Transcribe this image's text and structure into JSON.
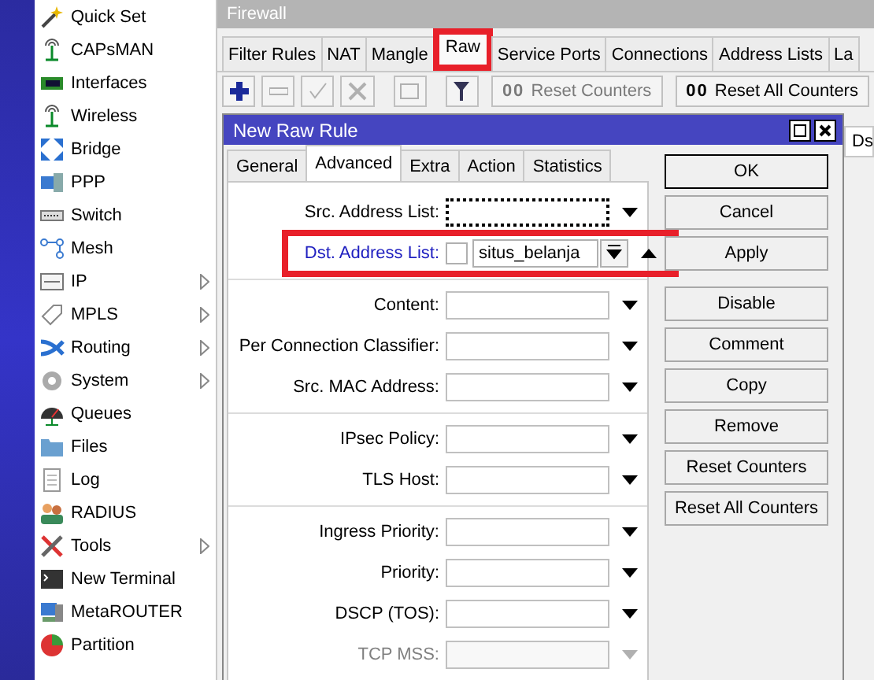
{
  "sidebar": {
    "items": [
      {
        "label": "Quick Set",
        "submenu": false
      },
      {
        "label": "CAPsMAN",
        "submenu": false
      },
      {
        "label": "Interfaces",
        "submenu": false
      },
      {
        "label": "Wireless",
        "submenu": false
      },
      {
        "label": "Bridge",
        "submenu": false
      },
      {
        "label": "PPP",
        "submenu": false
      },
      {
        "label": "Switch",
        "submenu": false
      },
      {
        "label": "Mesh",
        "submenu": false
      },
      {
        "label": "IP",
        "submenu": true
      },
      {
        "label": "MPLS",
        "submenu": true
      },
      {
        "label": "Routing",
        "submenu": true
      },
      {
        "label": "System",
        "submenu": true
      },
      {
        "label": "Queues",
        "submenu": false
      },
      {
        "label": "Files",
        "submenu": false
      },
      {
        "label": "Log",
        "submenu": false
      },
      {
        "label": "RADIUS",
        "submenu": false
      },
      {
        "label": "Tools",
        "submenu": true
      },
      {
        "label": "New Terminal",
        "submenu": false
      },
      {
        "label": "MetaROUTER",
        "submenu": false
      },
      {
        "label": "Partition",
        "submenu": false
      }
    ]
  },
  "window": {
    "title": "Firewall",
    "tabs": [
      {
        "label": "Filter Rules",
        "selected": false,
        "highlighted": false
      },
      {
        "label": "NAT",
        "selected": false,
        "highlighted": false
      },
      {
        "label": "Mangle",
        "selected": false,
        "highlighted": false
      },
      {
        "label": "Raw",
        "selected": true,
        "highlighted": true
      },
      {
        "label": "Service Ports",
        "selected": false,
        "highlighted": false
      },
      {
        "label": "Connections",
        "selected": false,
        "highlighted": false
      },
      {
        "label": "Address Lists",
        "selected": false,
        "highlighted": false
      },
      {
        "label": "La",
        "selected": false,
        "highlighted": false
      }
    ],
    "toolbar": [
      {
        "kind": "add",
        "disabled": false
      },
      {
        "kind": "remove",
        "disabled": true
      },
      {
        "kind": "enable",
        "disabled": true
      },
      {
        "kind": "disable",
        "disabled": true
      },
      {
        "kind": "comment",
        "disabled": true
      },
      {
        "kind": "filter",
        "disabled": false
      },
      {
        "kind": "counter",
        "badge": "00",
        "label": "Reset Counters",
        "disabled": true
      },
      {
        "kind": "counter",
        "badge": "00",
        "label": "Reset All Counters",
        "disabled": false
      }
    ],
    "column_header": "Ds"
  },
  "dialog": {
    "title": "New Raw Rule",
    "tabs": [
      {
        "label": "General",
        "selected": false
      },
      {
        "label": "Advanced",
        "selected": true
      },
      {
        "label": "Extra",
        "selected": false
      },
      {
        "label": "Action",
        "selected": false
      },
      {
        "label": "Statistics",
        "selected": false
      }
    ],
    "groups": [
      [
        {
          "label": "Src. Address List:",
          "set": false,
          "focused": true,
          "disabled": false,
          "highlighted": false
        },
        {
          "label": "Dst. Address List:",
          "set": true,
          "negated": false,
          "value": "situs_belanja",
          "focused": false,
          "disabled": false,
          "highlighted": true
        }
      ],
      [
        {
          "label": "Content:",
          "set": false,
          "focused": false,
          "disabled": false,
          "highlighted": false
        },
        {
          "label": "Per Connection Classifier:",
          "set": false,
          "focused": false,
          "disabled": false,
          "highlighted": false
        },
        {
          "label": "Src. MAC Address:",
          "set": false,
          "focused": false,
          "disabled": false,
          "highlighted": false
        }
      ],
      [
        {
          "label": "IPsec Policy:",
          "set": false,
          "focused": false,
          "disabled": false,
          "highlighted": false
        },
        {
          "label": "TLS Host:",
          "set": false,
          "focused": false,
          "disabled": false,
          "highlighted": false
        }
      ],
      [
        {
          "label": "Ingress Priority:",
          "set": false,
          "focused": false,
          "disabled": false,
          "highlighted": false
        },
        {
          "label": "Priority:",
          "set": false,
          "focused": false,
          "disabled": false,
          "highlighted": false
        },
        {
          "label": "DSCP (TOS):",
          "set": false,
          "focused": false,
          "disabled": false,
          "highlighted": false
        },
        {
          "label": "TCP MSS:",
          "set": false,
          "focused": false,
          "disabled": true,
          "highlighted": false
        }
      ]
    ],
    "button_groups": [
      [
        {
          "label": "OK",
          "default": true
        },
        {
          "label": "Cancel",
          "default": false
        },
        {
          "label": "Apply",
          "default": false
        }
      ],
      [
        {
          "label": "Disable",
          "default": false
        },
        {
          "label": "Comment",
          "default": false
        },
        {
          "label": "Copy",
          "default": false
        },
        {
          "label": "Remove",
          "default": false
        },
        {
          "label": "Reset Counters",
          "default": false
        },
        {
          "label": "Reset All Counters",
          "default": false
        }
      ]
    ]
  }
}
